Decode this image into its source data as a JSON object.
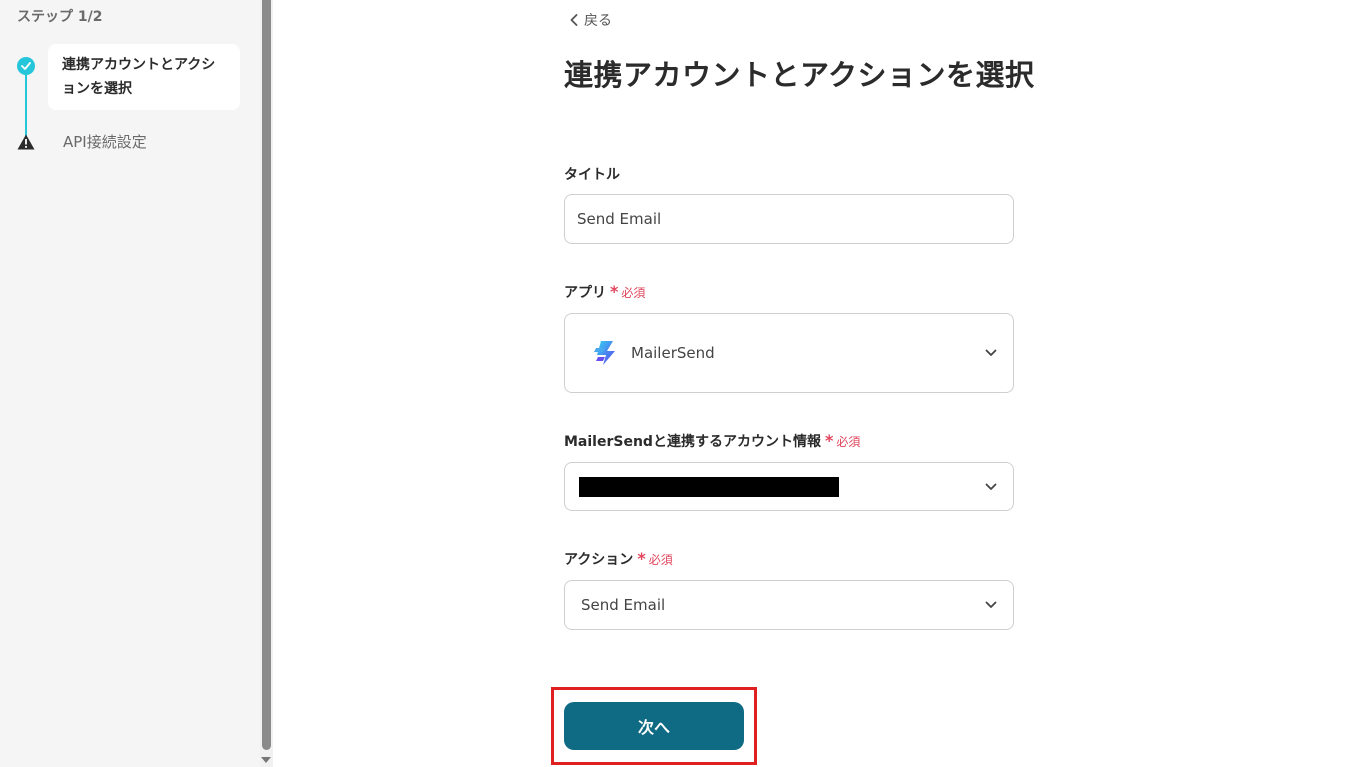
{
  "sidebar": {
    "step_header": "ステップ 1/2",
    "steps": [
      {
        "label": "連携アカウントとアクションを選択",
        "status": "complete"
      },
      {
        "label": "API接続設定",
        "status": "warning"
      }
    ]
  },
  "header": {
    "back_label": "戻る",
    "title": "連携アカウントとアクションを選択"
  },
  "form": {
    "title_field": {
      "label": "タイトル",
      "value": "Send Email"
    },
    "app_field": {
      "label": "アプリ",
      "required_label": "必須",
      "value": "MailerSend",
      "icon": "mailersend-logo-icon"
    },
    "account_field": {
      "label": "MailerSendと連携するアカウント情報",
      "required_label": "必須",
      "value_redacted": true
    },
    "action_field": {
      "label": "アクション",
      "required_label": "必須",
      "value": "Send Email"
    }
  },
  "next_button": {
    "label": "次へ"
  },
  "colors": {
    "accent": "#26c6da",
    "primary_button": "#0f6a84",
    "required": "#e0455c",
    "highlight": "#e02020"
  }
}
